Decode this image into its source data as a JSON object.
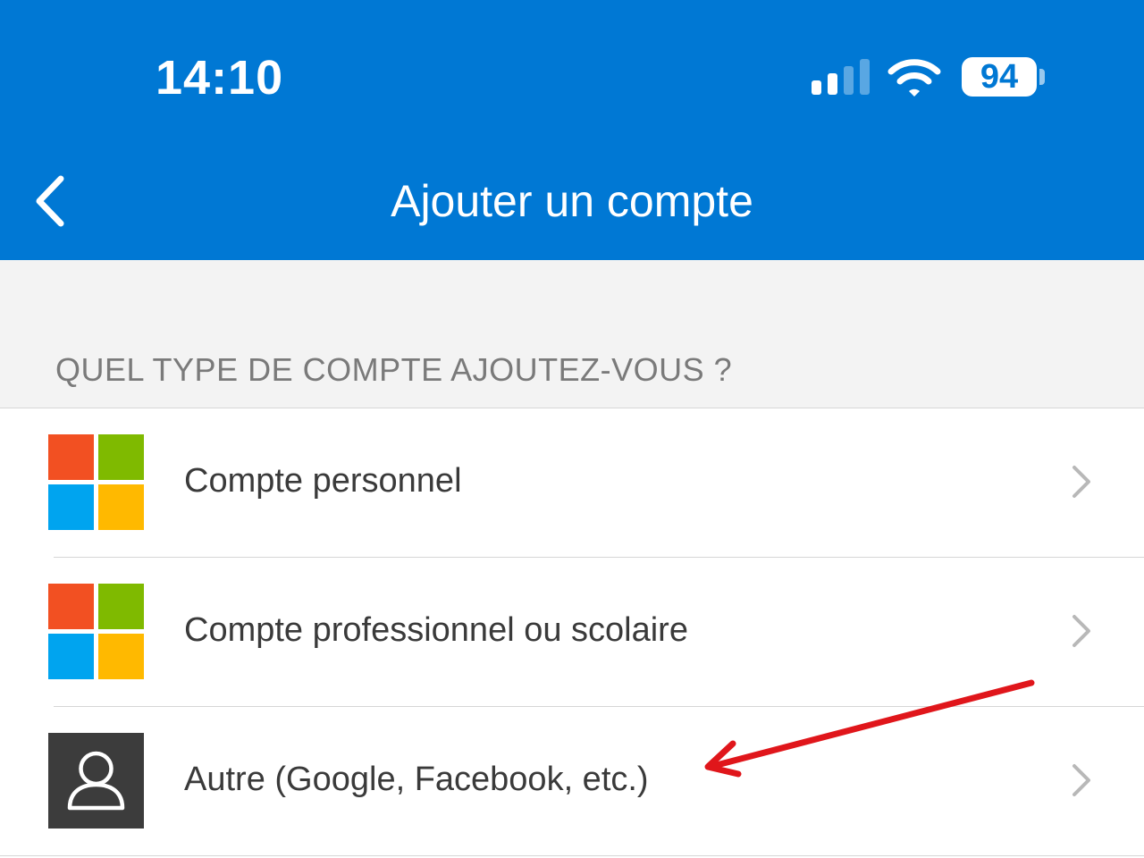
{
  "status_bar": {
    "time": "14:10",
    "battery_level": "94",
    "signal_bars_active": 2,
    "signal_bars_total": 4
  },
  "header": {
    "title": "Ajouter un compte",
    "back_icon": "chevron-left-icon"
  },
  "section": {
    "title": "QUEL TYPE DE COMPTE AJOUTEZ-VOUS ?"
  },
  "account_types": [
    {
      "label": "Compte personnel",
      "icon": "microsoft-logo-icon"
    },
    {
      "label": "Compte professionnel ou scolaire",
      "icon": "microsoft-logo-icon"
    },
    {
      "label": "Autre (Google, Facebook, etc.)",
      "icon": "person-icon"
    }
  ],
  "colors": {
    "header_bg": "#0078d4",
    "section_bg": "#f3f3f3",
    "ms_red": "#f25022",
    "ms_green": "#7fba00",
    "ms_blue": "#00a4ef",
    "ms_yellow": "#ffb900",
    "person_tile": "#3c3c3c",
    "annotation_arrow": "#e0161b"
  }
}
